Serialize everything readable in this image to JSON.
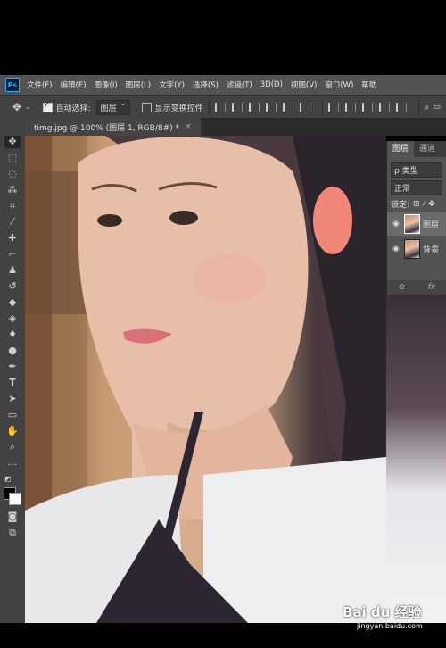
{
  "app": {
    "logo": "Ps"
  },
  "menu": [
    "文件(F)",
    "编辑(E)",
    "图像(I)",
    "图层(L)",
    "文字(Y)",
    "选择(S)",
    "滤镜(T)",
    "3D(D)",
    "视图(V)",
    "窗口(W)",
    "帮助"
  ],
  "options": {
    "auto_select_label": "自动选择:",
    "auto_select_value": "图层",
    "show_transform_label": "显示变换控件"
  },
  "document": {
    "tab_title": "timg.jpg @ 100% (图层 1, RGB/8#) *",
    "close": "×"
  },
  "layers_panel": {
    "tabs": [
      "图层",
      "通道"
    ],
    "filter_value": "ρ 类型",
    "blend_mode": "正常",
    "lock_label": "锁定:",
    "layers": [
      {
        "name": "图层",
        "selected": true
      },
      {
        "name": "背景",
        "selected": false
      }
    ],
    "footer": [
      "⊖",
      "fx"
    ]
  },
  "watermark": {
    "logo": "Bai du 经验",
    "sub": "jingyan.baidu.com"
  }
}
